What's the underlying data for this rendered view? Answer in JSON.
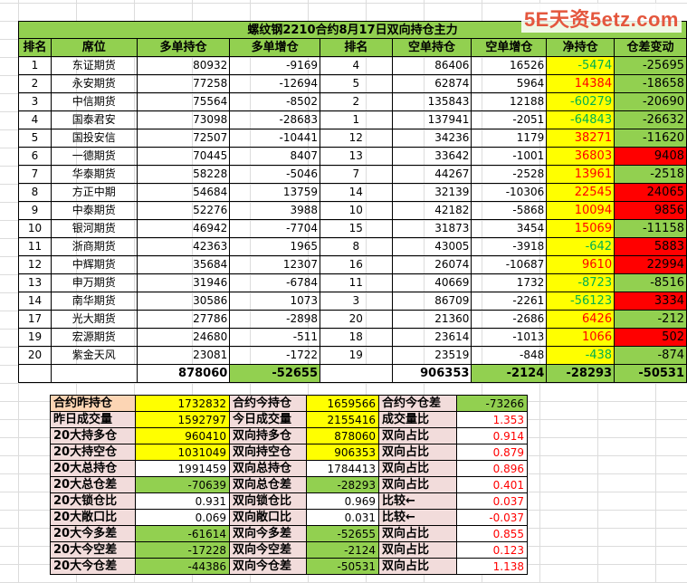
{
  "watermark": "5E天资5etz.com",
  "title": "螺纹钢2210合约8月17日双向持仓主力",
  "headers": [
    "排名",
    "席位",
    "多单持仓",
    "多单增仓",
    "排名",
    "空单持仓",
    "空单增仓",
    "净持仓",
    "仓差变动"
  ],
  "rows": [
    {
      "rank": "1",
      "name": "东证期货",
      "long": "80932",
      "long_chg": "-9169",
      "srank": "4",
      "short": "86406",
      "short_chg": "16526",
      "net": "-5474",
      "diff": "-25695"
    },
    {
      "rank": "2",
      "name": "永安期货",
      "long": "77258",
      "long_chg": "-12694",
      "srank": "5",
      "short": "62874",
      "short_chg": "5964",
      "net": "14384",
      "diff": "-18658"
    },
    {
      "rank": "3",
      "name": "中信期货",
      "long": "75564",
      "long_chg": "-8502",
      "srank": "2",
      "short": "135843",
      "short_chg": "12188",
      "net": "-60279",
      "diff": "-20690"
    },
    {
      "rank": "4",
      "name": "国泰君安",
      "long": "73098",
      "long_chg": "-28683",
      "srank": "1",
      "short": "137941",
      "short_chg": "-2051",
      "net": "-64843",
      "diff": "-26632"
    },
    {
      "rank": "5",
      "name": "国投安信",
      "long": "72507",
      "long_chg": "-10441",
      "srank": "12",
      "short": "34236",
      "short_chg": "1179",
      "net": "38271",
      "diff": "-11620"
    },
    {
      "rank": "6",
      "name": "一德期货",
      "long": "70445",
      "long_chg": "8407",
      "srank": "13",
      "short": "33642",
      "short_chg": "-1001",
      "net": "36803",
      "diff": "9408"
    },
    {
      "rank": "7",
      "name": "华泰期货",
      "long": "58228",
      "long_chg": "-5046",
      "srank": "7",
      "short": "44267",
      "short_chg": "-2528",
      "net": "13961",
      "diff": "-2518"
    },
    {
      "rank": "8",
      "name": "方正中期",
      "long": "54684",
      "long_chg": "13759",
      "srank": "14",
      "short": "32139",
      "short_chg": "-10306",
      "net": "22545",
      "diff": "24065"
    },
    {
      "rank": "9",
      "name": "中泰期货",
      "long": "52276",
      "long_chg": "3988",
      "srank": "10",
      "short": "42182",
      "short_chg": "-5868",
      "net": "10094",
      "diff": "9856"
    },
    {
      "rank": "10",
      "name": "银河期货",
      "long": "46942",
      "long_chg": "-7704",
      "srank": "15",
      "short": "31873",
      "short_chg": "3454",
      "net": "15069",
      "diff": "-11158"
    },
    {
      "rank": "11",
      "name": "浙商期货",
      "long": "42363",
      "long_chg": "1965",
      "srank": "8",
      "short": "43005",
      "short_chg": "-3918",
      "net": "-642",
      "diff": "5883"
    },
    {
      "rank": "12",
      "name": "中辉期货",
      "long": "35684",
      "long_chg": "12307",
      "srank": "16",
      "short": "26074",
      "short_chg": "-10687",
      "net": "9610",
      "diff": "22994"
    },
    {
      "rank": "13",
      "name": "申万期货",
      "long": "31946",
      "long_chg": "-6784",
      "srank": "11",
      "short": "40669",
      "short_chg": "1732",
      "net": "-8723",
      "diff": "-8516"
    },
    {
      "rank": "14",
      "name": "南华期货",
      "long": "30586",
      "long_chg": "1073",
      "srank": "3",
      "short": "86709",
      "short_chg": "-2261",
      "net": "-56123",
      "diff": "3334"
    },
    {
      "rank": "17",
      "name": "光大期货",
      "long": "27786",
      "long_chg": "-2898",
      "srank": "20",
      "short": "21360",
      "short_chg": "-2686",
      "net": "6426",
      "diff": "-212"
    },
    {
      "rank": "19",
      "name": "宏源期货",
      "long": "24680",
      "long_chg": "-511",
      "srank": "18",
      "short": "23614",
      "short_chg": "-1013",
      "net": "1066",
      "diff": "502"
    },
    {
      "rank": "20",
      "name": "紫金天风",
      "long": "23081",
      "long_chg": "-1722",
      "srank": "19",
      "short": "23519",
      "short_chg": "-848",
      "net": "-438",
      "diff": "-874"
    }
  ],
  "totals": {
    "long": "878060",
    "long_chg": "-52655",
    "short": "906353",
    "short_chg": "-2124",
    "net": "-28293",
    "diff": "-50531"
  },
  "summary": [
    [
      "合约昨持仓",
      "1732832",
      "合约今持仓",
      "1659566",
      "合约今仓差",
      "-73266"
    ],
    [
      "昨日成交量",
      "1592797",
      "今日成交量",
      "2155416",
      "成交量比",
      "1.353"
    ],
    [
      "20大持多仓",
      "960410",
      "双向持多仓",
      "878060",
      "双向占比",
      "0.914"
    ],
    [
      "20大持空仓",
      "1031049",
      "双向持空仓",
      "906353",
      "双向占比",
      "0.879"
    ],
    [
      "20大总持仓",
      "1991459",
      "双向总持仓",
      "1784413",
      "双向占比",
      "0.896"
    ],
    [
      "20大总仓差",
      "-70639",
      "双向总仓差",
      "-28293",
      "双向占比",
      "0.401"
    ],
    [
      "20大锁仓比",
      "0.931",
      "双向锁仓比",
      "0.969",
      "比较←",
      "0.037"
    ],
    [
      "20大敞口比",
      "0.069",
      "双向敞口比",
      "0.031",
      "比较←",
      "-0.037"
    ],
    [
      "20大今多差",
      "-61614",
      "双向今多差",
      "-52655",
      "双向占比",
      "0.855"
    ],
    [
      "20大今空差",
      "-17228",
      "双向今空差",
      "-2124",
      "双向占比",
      "0.123"
    ],
    [
      "20大今仓差",
      "-44386",
      "双向今仓差",
      "-50531",
      "双向占比",
      "1.138"
    ]
  ]
}
